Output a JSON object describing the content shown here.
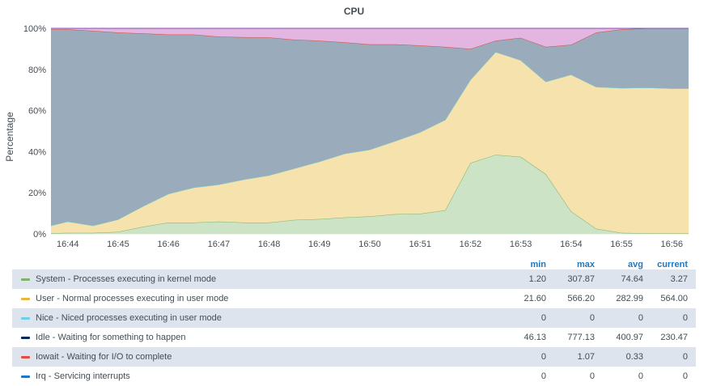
{
  "panel": {
    "title": "CPU"
  },
  "legend": {
    "columns": {
      "min": "min",
      "max": "max",
      "avg": "avg",
      "current": "current"
    },
    "rows": [
      {
        "name": "System - Processes executing in kernel mode",
        "color": "#7eb26d",
        "min": "1.20",
        "max": "307.87",
        "avg": "74.64",
        "current": "3.27"
      },
      {
        "name": "User - Normal processes executing in user mode",
        "color": "#eab839",
        "min": "21.60",
        "max": "566.20",
        "avg": "282.99",
        "current": "564.00"
      },
      {
        "name": "Nice - Niced processes executing in user mode",
        "color": "#6ed0e0",
        "min": "0",
        "max": "0",
        "avg": "0",
        "current": "0"
      },
      {
        "name": "Idle - Waiting for something to happen",
        "color": "#052b51",
        "min": "46.13",
        "max": "777.13",
        "avg": "400.97",
        "current": "230.47"
      },
      {
        "name": "Iowait - Waiting for I/O to complete",
        "color": "#e24d42",
        "min": "0",
        "max": "1.07",
        "avg": "0.33",
        "current": "0"
      },
      {
        "name": "Irq - Servicing interrupts",
        "color": "#1f78c1",
        "min": "0",
        "max": "0",
        "avg": "0",
        "current": "0"
      }
    ]
  },
  "chart_data": {
    "type": "area",
    "stacked": true,
    "percent": true,
    "title": "CPU",
    "ylabel": "Percentage",
    "xlabel": "",
    "ylim": [
      0,
      100
    ],
    "yticks": [
      "0%",
      "20%",
      "40%",
      "60%",
      "80%",
      "100%"
    ],
    "xlim": [
      "16:43:40",
      "16:56:20"
    ],
    "xticks": [
      "16:44",
      "16:45",
      "16:46",
      "16:47",
      "16:48",
      "16:49",
      "16:50",
      "16:51",
      "16:52",
      "16:53",
      "16:54",
      "16:55",
      "16:56"
    ],
    "x": [
      "16:43:40",
      "16:44:00",
      "16:44:30",
      "16:45:00",
      "16:45:30",
      "16:46:00",
      "16:46:30",
      "16:47:00",
      "16:47:30",
      "16:48:00",
      "16:48:30",
      "16:49:00",
      "16:49:30",
      "16:50:00",
      "16:50:30",
      "16:51:00",
      "16:51:30",
      "16:52:00",
      "16:52:30",
      "16:53:00",
      "16:53:30",
      "16:54:00",
      "16:54:30",
      "16:55:00",
      "16:55:30",
      "16:56:00",
      "16:56:20"
    ],
    "series": [
      {
        "name": "System",
        "color": "#7eb26d",
        "fill": "#cce3c6",
        "values": [
          0.3,
          0.5,
          0.5,
          1.0,
          3.5,
          5.5,
          5.5,
          6.0,
          5.5,
          5.5,
          6.8,
          7.2,
          8.0,
          8.5,
          9.6,
          9.8,
          11.5,
          34.5,
          38.5,
          37.5,
          29.0,
          11.0,
          2.5,
          0.5,
          0.3,
          0.2,
          0.2
        ]
      },
      {
        "name": "User",
        "color": "#eab839",
        "fill": "#f5e2ad",
        "values": [
          3.7,
          5.5,
          3.5,
          6.0,
          10.0,
          14.0,
          17.0,
          18.0,
          21.0,
          23.0,
          25.0,
          28.0,
          31.0,
          32.5,
          35.5,
          39.7,
          44.0,
          40.5,
          50.0,
          47.0,
          45.0,
          66.5,
          69.0,
          70.5,
          70.9,
          70.6,
          70.6
        ]
      },
      {
        "name": "Nice",
        "color": "#6ed0e0",
        "fill": "#c8eef4",
        "values": [
          0,
          0,
          0,
          0,
          0,
          0,
          0,
          0,
          0,
          0,
          0,
          0,
          0,
          0,
          0,
          0,
          0,
          0,
          0,
          0,
          0,
          0,
          0,
          0,
          0,
          0,
          0
        ]
      },
      {
        "name": "Idle",
        "color": "#7a8794",
        "fill": "#9aabbb",
        "values": [
          95.5,
          93.5,
          94.8,
          91.0,
          84.0,
          77.5,
          74.5,
          72.0,
          69.2,
          67.1,
          62.7,
          58.8,
          54.2,
          51.2,
          47.1,
          42.2,
          35.5,
          15.0,
          5.5,
          10.9,
          17.0,
          14.5,
          26.5,
          28.5,
          28.8,
          29.2,
          29.2
        ]
      },
      {
        "name": "Iowait",
        "color": "#e24d42",
        "fill": "#f4c2bf",
        "values": [
          0,
          0,
          0,
          0,
          0,
          0,
          0,
          0,
          0,
          0,
          0,
          0,
          0,
          0,
          0,
          0,
          0,
          0,
          0,
          0,
          0,
          0,
          0,
          0,
          0,
          0,
          0
        ]
      },
      {
        "name": "Irq",
        "color": "#8a4fb5",
        "fill": "#e3b6e1",
        "values": [
          0.5,
          0.5,
          1.2,
          2.0,
          2.5,
          3.0,
          3.0,
          4.0,
          4.3,
          4.4,
          5.5,
          6.0,
          6.8,
          7.8,
          7.8,
          8.3,
          9.0,
          10.0,
          6.0,
          4.6,
          9.0,
          8.0,
          2.0,
          0.5,
          0.0,
          0.0,
          0.0
        ]
      }
    ]
  }
}
